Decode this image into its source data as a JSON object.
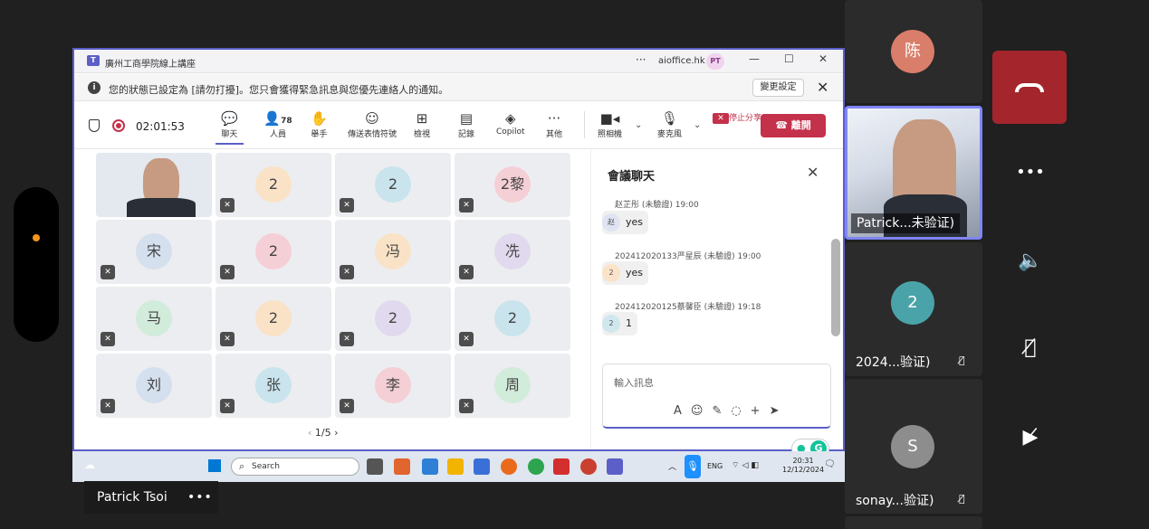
{
  "window": {
    "title": "廣州工商學院線上講座",
    "org": "aioffice.hk",
    "initials": "PT",
    "more": "···",
    "minimize": "—",
    "maximize": "☐",
    "close": "✕"
  },
  "notice": {
    "text": "您的狀態已設定為 [請勿打擾]。您只會獲得緊急訊息與您優先連絡人的通知。",
    "change_label": "變更設定"
  },
  "toolbar": {
    "timer": "02:01:53",
    "people_count": "78",
    "items": [
      {
        "label": "聊天",
        "icon": "chat-icon"
      },
      {
        "label": "人員",
        "icon": "people-icon"
      },
      {
        "label": "舉手",
        "icon": "raise-hand-icon"
      },
      {
        "label": "傳送表情符號",
        "icon": "emoji-icon"
      },
      {
        "label": "檢視",
        "icon": "view-icon"
      },
      {
        "label": "記錄",
        "icon": "notes-icon"
      },
      {
        "label": "Copilot",
        "icon": "copilot-icon"
      },
      {
        "label": "其他",
        "icon": "more-icon"
      },
      {
        "label": "照相機",
        "icon": "camera-icon"
      },
      {
        "label": "麥克風",
        "icon": "mic-icon"
      },
      {
        "label": "停止分享",
        "icon": "stop-share-icon"
      }
    ],
    "leave_label": "離開"
  },
  "grid": {
    "tiles": [
      {
        "label": "",
        "color": "#ffffff"
      },
      {
        "label": "2",
        "color": "#f9e2c6"
      },
      {
        "label": "2",
        "color": "#c9e4ec"
      },
      {
        "label": "2黎",
        "color": "#f5cfd6"
      },
      {
        "label": "宋",
        "color": "#d4e0ee"
      },
      {
        "label": "2",
        "color": "#f5cfd6"
      },
      {
        "label": "冯",
        "color": "#f9e2c6"
      },
      {
        "label": "冼",
        "color": "#e1d9ee"
      },
      {
        "label": "马",
        "color": "#d2ecdb"
      },
      {
        "label": "2",
        "color": "#f9e2c6"
      },
      {
        "label": "2",
        "color": "#e1d9ee"
      },
      {
        "label": "2",
        "color": "#c9e4ec"
      },
      {
        "label": "刘",
        "color": "#d4e0ee"
      },
      {
        "label": "张",
        "color": "#c9e4ec"
      },
      {
        "label": "李",
        "color": "#f5cfd6"
      },
      {
        "label": "周",
        "color": "#d2ecdb"
      }
    ],
    "pager": "1/5"
  },
  "chat": {
    "title": "會議聊天",
    "messages": [
      {
        "meta": "赵芷彤 (未驗證)  19:00",
        "avatar": "赵",
        "text": "yes"
      },
      {
        "meta": "202412020133严星辰 (未驗證)  19:00",
        "avatar": "2",
        "text": "yes"
      },
      {
        "meta": "202412020125蔡馨臣 (未驗證)  19:18",
        "avatar": "2",
        "text": "1"
      }
    ],
    "input_placeholder": "輸入訊息",
    "input_tools": "A☺✎◌+➤"
  },
  "taskbar": {
    "search_placeholder": "Search",
    "lang": "ENG",
    "time": "20:31",
    "date": "12/12/2024"
  },
  "presenter": {
    "name": "Patrick Tsoi",
    "more": "•••"
  },
  "participants": [
    {
      "initial": "陈",
      "color": "#d97e6a",
      "name": ""
    },
    {
      "initial": "",
      "color": "",
      "name": "Patrick...未验证)"
    },
    {
      "initial": "2",
      "color": "#4aa3a8",
      "name": "2024...验证)"
    },
    {
      "initial": "S",
      "color": "#8d8d8d",
      "name": "sonay...验证)"
    }
  ],
  "controls": {
    "more": "•••",
    "speaker": "speaker-icon",
    "mic": "mic-off-icon",
    "camera": "camera-off-icon"
  },
  "colors": {
    "accent": "#5b5fc7",
    "leave": "#c4314b",
    "hangup": "#a4262c"
  }
}
